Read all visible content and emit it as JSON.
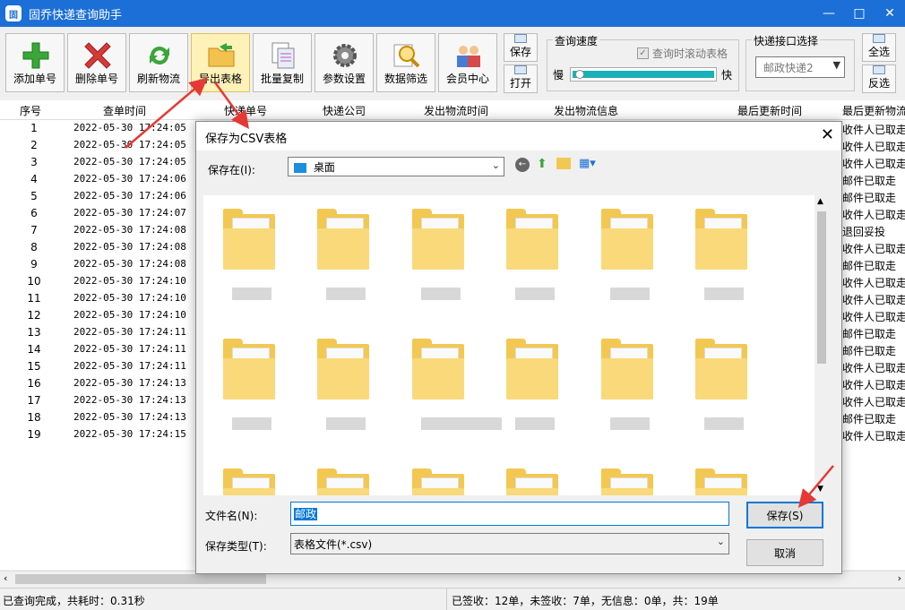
{
  "window": {
    "title": "固乔快递查询助手",
    "icon_text": "固"
  },
  "toolbar": {
    "buttons": [
      {
        "label": "添加单号"
      },
      {
        "label": "删除单号"
      },
      {
        "label": "刷新物流"
      },
      {
        "label": "导出表格"
      },
      {
        "label": "批量复制"
      },
      {
        "label": "参数设置"
      },
      {
        "label": "数据筛选"
      },
      {
        "label": "会员中心"
      }
    ],
    "save_label": "保存",
    "open_label": "打开",
    "speed_group": "查询速度",
    "scroll_checkbox": "查询时滚动表格",
    "slow": "慢",
    "fast": "快",
    "speed_level": 0.02,
    "api_group": "快递接口选择",
    "api_selected": "邮政快递2",
    "select_all": "全选",
    "invert": "反选"
  },
  "grid": {
    "headers": [
      "序号",
      "查单时间",
      "快递单号",
      "快递公司",
      "发出物流时间",
      "发出物流信息",
      "最后更新时间",
      "最后更新物流"
    ],
    "rows": [
      {
        "seq": "1",
        "time": "2022-05-30  17:24:05",
        "info": "收件人已取走"
      },
      {
        "seq": "2",
        "time": "2022-05-30  17:24:05",
        "info": "收件人已取走"
      },
      {
        "seq": "3",
        "time": "2022-05-30  17:24:05",
        "info": "收件人已取走"
      },
      {
        "seq": "4",
        "time": "2022-05-30  17:24:06",
        "info": "邮件已取走"
      },
      {
        "seq": "5",
        "time": "2022-05-30  17:24:06",
        "info": "邮件已取走"
      },
      {
        "seq": "6",
        "time": "2022-05-30  17:24:07",
        "info": "收件人已取走"
      },
      {
        "seq": "7",
        "time": "2022-05-30  17:24:08",
        "info": "退回妥投"
      },
      {
        "seq": "8",
        "time": "2022-05-30  17:24:08",
        "info": "收件人已取走"
      },
      {
        "seq": "9",
        "time": "2022-05-30  17:24:08",
        "info": "邮件已取走"
      },
      {
        "seq": "10",
        "time": "2022-05-30  17:24:10",
        "info": "收件人已取走"
      },
      {
        "seq": "11",
        "time": "2022-05-30  17:24:10",
        "info": "收件人已取走"
      },
      {
        "seq": "12",
        "time": "2022-05-30  17:24:10",
        "info": "收件人已取走"
      },
      {
        "seq": "13",
        "time": "2022-05-30  17:24:11",
        "info": "邮件已取走"
      },
      {
        "seq": "14",
        "time": "2022-05-30  17:24:11",
        "info": "邮件已取走"
      },
      {
        "seq": "15",
        "time": "2022-05-30  17:24:11",
        "info": "收件人已取走"
      },
      {
        "seq": "16",
        "time": "2022-05-30  17:24:13",
        "info": "收件人已取走"
      },
      {
        "seq": "17",
        "time": "2022-05-30  17:24:13",
        "info": "收件人已取走"
      },
      {
        "seq": "18",
        "time": "2022-05-30  17:24:13",
        "info": "邮件已取走"
      },
      {
        "seq": "19",
        "time": "2022-05-30  17:24:15",
        "info": "收件人已取走"
      }
    ]
  },
  "status": {
    "left": "已查询完成，共耗时：0.31秒",
    "right": "已签收：12单，未签收：7单，无信息：0单，共：19单"
  },
  "dialog": {
    "title": "保存为CSV表格",
    "save_in_label": "保存在(I):",
    "location": "桌面",
    "filename_label": "文件名(N):",
    "filename_value": "邮政",
    "filetype_label": "保存类型(T):",
    "filetype_value": "表格文件(*.csv)",
    "save_button": "保存(S)",
    "cancel_button": "取消"
  },
  "colors": {
    "titlebar": "#1c6fd6",
    "highlight": "#fff2b8",
    "annotation_arrow": "#e53935",
    "folder": "#f3c852"
  }
}
